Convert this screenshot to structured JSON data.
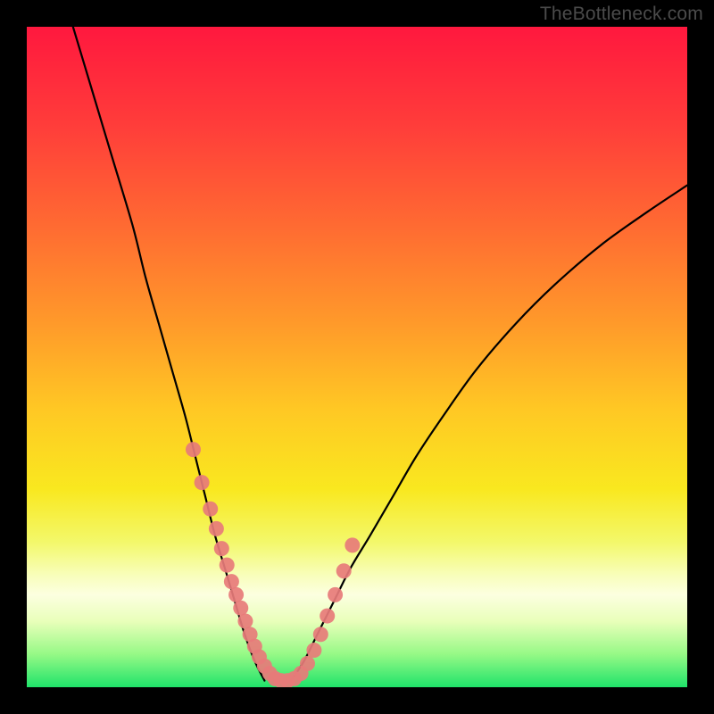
{
  "watermark": "TheBottleneck.com",
  "colors": {
    "frame": "#000000",
    "curve": "#000000",
    "marker_fill": "#e77b79",
    "marker_stroke": "#e77b79",
    "gradient_stops": [
      {
        "offset": 0.0,
        "color": "#ff183e"
      },
      {
        "offset": 0.15,
        "color": "#ff3d3a"
      },
      {
        "offset": 0.3,
        "color": "#ff6a32"
      },
      {
        "offset": 0.45,
        "color": "#ff9a2a"
      },
      {
        "offset": 0.58,
        "color": "#ffc824"
      },
      {
        "offset": 0.7,
        "color": "#f9e81f"
      },
      {
        "offset": 0.78,
        "color": "#f3f86a"
      },
      {
        "offset": 0.83,
        "color": "#f8feba"
      },
      {
        "offset": 0.86,
        "color": "#fcffe0"
      },
      {
        "offset": 0.9,
        "color": "#e9ffba"
      },
      {
        "offset": 0.95,
        "color": "#96f986"
      },
      {
        "offset": 1.0,
        "color": "#1fe36a"
      }
    ]
  },
  "chart_data": {
    "type": "line",
    "title": "",
    "xlabel": "",
    "ylabel": "",
    "xlim": [
      0,
      100
    ],
    "ylim": [
      0,
      100
    ],
    "series": [
      {
        "name": "left-curve",
        "x": [
          7,
          10,
          13,
          16,
          18,
          20,
          22,
          24,
          25.5,
          27,
          28.5,
          30,
          31.5,
          33,
          34.5,
          36
        ],
        "y": [
          100,
          90,
          80,
          70,
          62,
          55,
          48,
          41,
          35,
          29,
          23,
          18,
          13,
          8,
          4,
          1
        ]
      },
      {
        "name": "right-curve",
        "x": [
          40,
          42,
          44,
          46.5,
          49,
          52,
          55.5,
          59,
          63,
          68,
          74,
          80,
          87,
          94,
          100
        ],
        "y": [
          1,
          4,
          8,
          13,
          18,
          23,
          29,
          35,
          41,
          48,
          55,
          61,
          67,
          72,
          76
        ]
      }
    ],
    "markers": {
      "name": "highlighted-points",
      "x": [
        25.2,
        26.5,
        27.8,
        28.7,
        29.5,
        30.3,
        31.0,
        31.7,
        32.4,
        33.1,
        33.8,
        34.5,
        35.2,
        36.0,
        36.8,
        37.6,
        38.5,
        39.5,
        40.5,
        41.5,
        42.5,
        43.5,
        44.5,
        45.5,
        46.7,
        48.0,
        49.3
      ],
      "y": [
        36,
        31,
        27,
        24,
        21,
        18.5,
        16,
        14,
        12,
        10,
        8,
        6.2,
        4.6,
        3.2,
        2.1,
        1.3,
        1.0,
        1.0,
        1.3,
        2.1,
        3.6,
        5.6,
        8.0,
        10.8,
        14.0,
        17.6,
        21.5
      ]
    }
  }
}
